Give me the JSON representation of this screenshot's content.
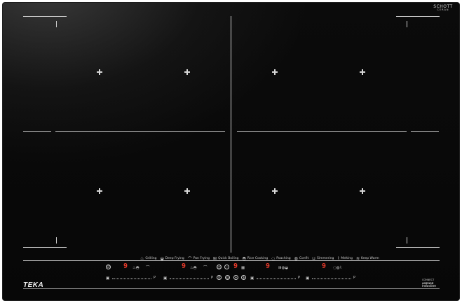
{
  "hob": {
    "brand": "TEKA",
    "glass_brand": "SCHOTT",
    "glass_sub": "CERAN",
    "badge": {
      "line1": "CONNECT",
      "line2": "&SENSE",
      "line3": "induction"
    }
  },
  "functions": [
    {
      "icon": "frying-icon",
      "label": "Grilling"
    },
    {
      "icon": "deep-frying-icon",
      "label": "Deep Frying"
    },
    {
      "icon": "pan-frying-icon",
      "label": "Pan Frying"
    },
    {
      "icon": "quick-boiling-icon",
      "label": "Quick Boiling"
    },
    {
      "icon": "rice-cooking-icon",
      "label": "Rice Cooking"
    },
    {
      "icon": "poaching-icon",
      "label": "Poaching"
    },
    {
      "icon": "confit-icon",
      "label": "Confit"
    },
    {
      "icon": "simmering-icon",
      "label": "Simmering"
    },
    {
      "icon": "melting-icon",
      "label": "Melting"
    },
    {
      "icon": "keep-warm-icon",
      "label": "Keep Warm"
    }
  ],
  "zones": [
    {
      "level": "9",
      "slider_end": "P"
    },
    {
      "level": "9",
      "slider_end": "P"
    },
    {
      "level": "9",
      "slider_end": "P"
    },
    {
      "level": "9",
      "slider_end": "P"
    }
  ],
  "controls": {
    "power_glyph": "⏻",
    "timer_minus": "−",
    "timer_plus": "+",
    "timer_value": "9"
  }
}
